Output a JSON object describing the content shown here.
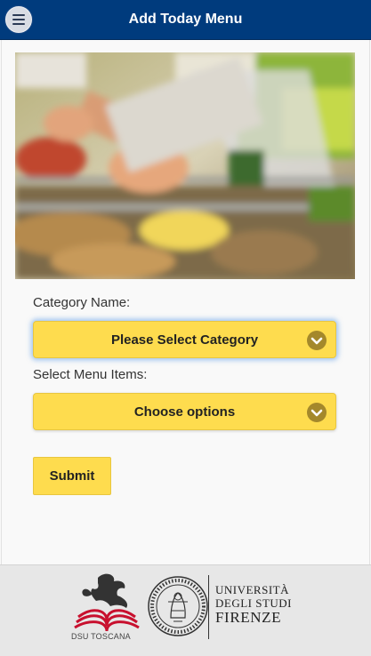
{
  "header": {
    "title": "Add Today Menu",
    "menu_icon": "hamburger-menu-icon"
  },
  "form": {
    "category_label": "Category Name:",
    "category_value": "Please Select Category",
    "items_label": "Select Menu Items:",
    "items_value": "Choose options",
    "submit_label": "Submit"
  },
  "footer": {
    "dsu_logo_text": "DSU TOSCANA",
    "seal_text": "SIGILLUM FLORENTINA STUDIORUM UNIVERSITAS",
    "university_lines": [
      "UNIVERSITÀ",
      "DEGLI STUDI",
      "FIRENZE"
    ]
  },
  "colors": {
    "header": "#003b7d",
    "accent": "#fedc4e"
  }
}
